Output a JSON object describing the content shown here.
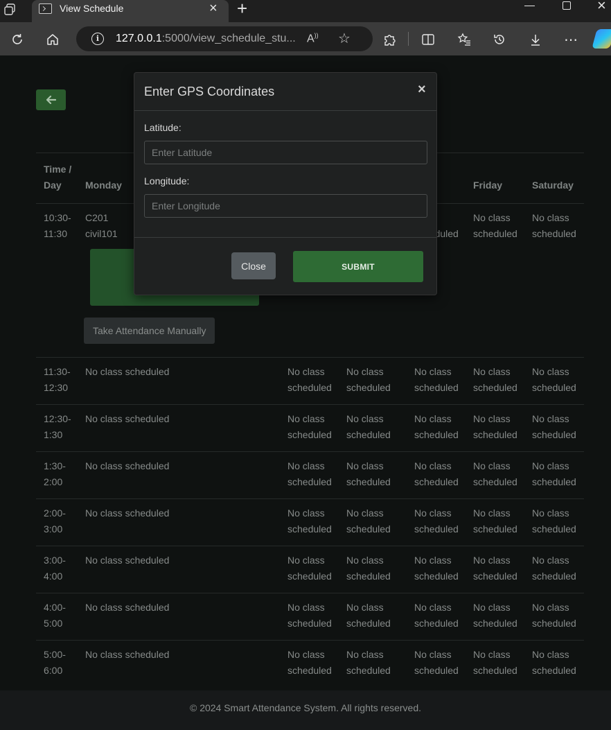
{
  "browser": {
    "tab_title": "View Schedule",
    "url_host": "127.0.0.1",
    "url_rest": ":5000/view_schedule_stu..."
  },
  "schedule": {
    "headers": [
      "Time / Day",
      "Monday",
      "",
      "",
      "sday",
      "Friday",
      "Saturday"
    ],
    "first_row": {
      "time": "10:30-11:30",
      "monday_room": "C201",
      "monday_course": "civil101",
      "manual_button": "Take Attendance Manually",
      "cells": [
        "",
        "",
        "lass scheduled",
        "No class scheduled",
        "No class scheduled"
      ]
    },
    "rows": [
      {
        "time": "11:30-12:30",
        "cells": [
          "No class scheduled",
          "No class scheduled",
          "No class scheduled",
          "No class scheduled",
          "No class scheduled",
          "No class scheduled"
        ]
      },
      {
        "time": "12:30-1:30",
        "cells": [
          "No class scheduled",
          "No class scheduled",
          "No class scheduled",
          "No class scheduled",
          "No class scheduled",
          "No class scheduled"
        ]
      },
      {
        "time": "1:30-2:00",
        "cells": [
          "No class scheduled",
          "No class scheduled",
          "No class scheduled",
          "No class scheduled",
          "No class scheduled",
          "No class scheduled"
        ]
      },
      {
        "time": "2:00-3:00",
        "cells": [
          "No class scheduled",
          "No class scheduled",
          "No class scheduled",
          "No class scheduled",
          "No class scheduled",
          "No class scheduled"
        ]
      },
      {
        "time": "3:00-4:00",
        "cells": [
          "No class scheduled",
          "No class scheduled",
          "No class scheduled",
          "No class scheduled",
          "No class scheduled",
          "No class scheduled"
        ]
      },
      {
        "time": "4:00-5:00",
        "cells": [
          "No class scheduled",
          "No class scheduled",
          "No class scheduled",
          "No class scheduled",
          "No class scheduled",
          "No class scheduled"
        ]
      },
      {
        "time": "5:00-6:00",
        "cells": [
          "No class scheduled",
          "No class scheduled",
          "No class scheduled",
          "No class scheduled",
          "No class scheduled",
          "No class scheduled"
        ]
      }
    ]
  },
  "footer": {
    "text": "© 2024 Smart Attendance System. All rights reserved."
  },
  "modal": {
    "title": "Enter GPS Coordinates",
    "close_x": "×",
    "latitude_label": "Latitude:",
    "latitude_placeholder": "Enter Latitude",
    "latitude_value": "",
    "longitude_label": "Longitude:",
    "longitude_placeholder": "Enter Longitude",
    "longitude_value": "",
    "close_button": "Close",
    "submit_button": "SUBMIT"
  },
  "colors": {
    "page_bg": "#0f1211",
    "accent_green": "#2e6b34",
    "modal_bg": "#1f2121",
    "chrome_bg": "#3b3b3b"
  }
}
